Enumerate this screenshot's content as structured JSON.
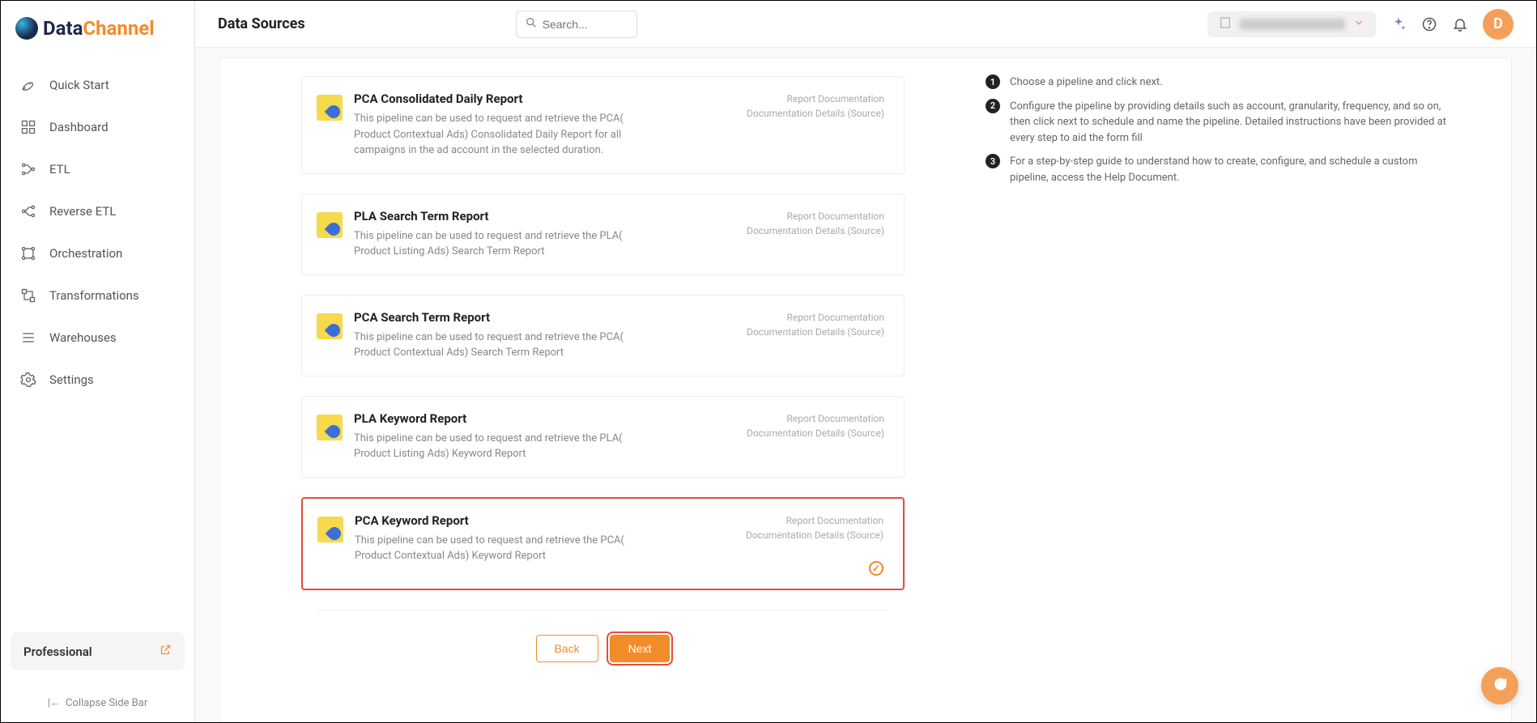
{
  "logo": {
    "part1": "Data",
    "part2": "Channel"
  },
  "header": {
    "title": "Data Sources",
    "search_placeholder": "Search...",
    "avatar_initial": "D"
  },
  "sidebar": {
    "items": [
      {
        "label": "Quick Start"
      },
      {
        "label": "Dashboard"
      },
      {
        "label": "ETL"
      },
      {
        "label": "Reverse ETL"
      },
      {
        "label": "Orchestration"
      },
      {
        "label": "Transformations"
      },
      {
        "label": "Warehouses"
      },
      {
        "label": "Settings"
      }
    ],
    "plan_label": "Professional",
    "collapse_label": "Collapse Side Bar"
  },
  "pipelines": [
    {
      "title": "PCA Consolidated Daily Report",
      "desc": "This pipeline can be used to request and retrieve the PCA( Product Contextual Ads) Consolidated Daily Report for all campaigns in the ad account in the selected duration.",
      "link1": "Report Documentation",
      "link2": "Documentation Details (Source)",
      "selected": false
    },
    {
      "title": "PLA Search Term Report",
      "desc": "This pipeline can be used to request and retrieve the PLA( Product Listing Ads) Search Term Report",
      "link1": "Report Documentation",
      "link2": "Documentation Details (Source)",
      "selected": false
    },
    {
      "title": "PCA Search Term Report",
      "desc": "This pipeline can be used to request and retrieve the PCA( Product Contextual Ads) Search Term Report",
      "link1": "Report Documentation",
      "link2": "Documentation Details (Source)",
      "selected": false
    },
    {
      "title": "PLA Keyword Report",
      "desc": "This pipeline can be used to request and retrieve the PLA( Product Listing Ads) Keyword Report",
      "link1": "Report Documentation",
      "link2": "Documentation Details (Source)",
      "selected": false
    },
    {
      "title": "PCA Keyword Report",
      "desc": "This pipeline can be used to request and retrieve the PCA( Product Contextual Ads) Keyword Report",
      "link1": "Report Documentation",
      "link2": "Documentation Details (Source)",
      "selected": true
    }
  ],
  "steps": [
    {
      "num": "1",
      "text": "Choose a pipeline and click next."
    },
    {
      "num": "2",
      "text": "Configure the pipeline by providing details such as account, granularity, frequency, and so on, then click next to schedule and name the pipeline. Detailed instructions have been provided at every step to aid the form fill"
    },
    {
      "num": "3",
      "text": "For a step-by-step guide to understand how to create, configure, and schedule a custom pipeline, access the Help Document."
    }
  ],
  "buttons": {
    "back": "Back",
    "next": "Next"
  }
}
